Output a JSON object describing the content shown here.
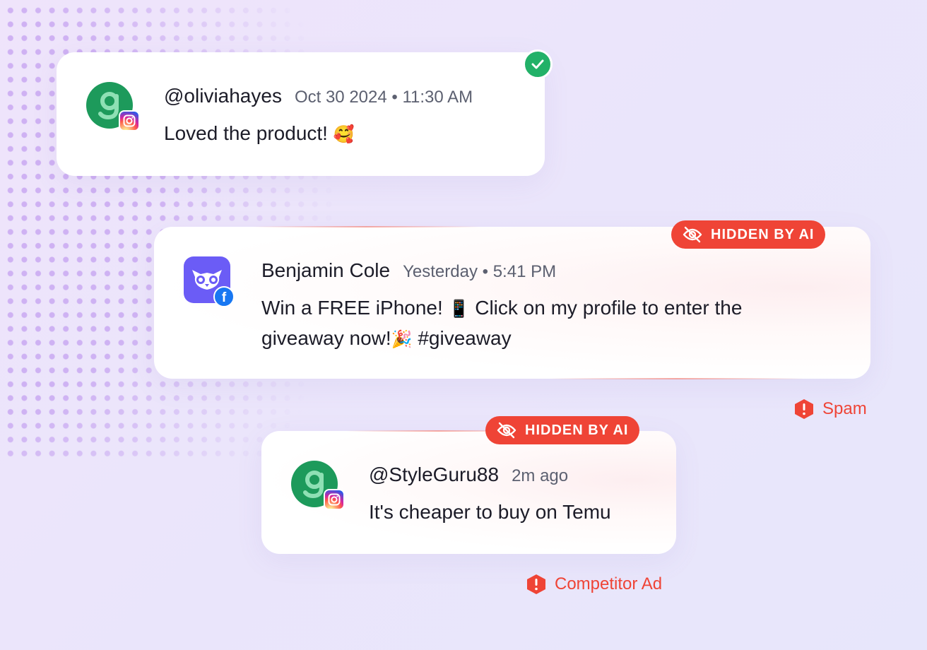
{
  "comments": [
    {
      "author": "@oliviahayes",
      "meta": "Oct 30 2024 • 11:30 AM",
      "text": "Loved the product!",
      "emoji": "🥰",
      "platform": "instagram",
      "status": "approved"
    },
    {
      "author": "Benjamin Cole",
      "meta": "Yesterday • 5:41 PM",
      "text_line1_a": "Win a FREE iPhone!",
      "text_line1_emoji": "📱",
      "text_line1_b": "Click on my profile to enter the",
      "text_line2_a": "giveaway now!",
      "text_line2_emoji": "🎉",
      "text_line2_b": "#giveaway",
      "platform": "facebook",
      "status_label": "HIDDEN BY AI",
      "reason": "Spam"
    },
    {
      "author": "@StyleGuru88",
      "meta": "2m ago",
      "text": "It's cheaper to buy on Temu",
      "platform": "instagram",
      "status_label": "HIDDEN BY AI",
      "reason": "Competitor Ad"
    }
  ],
  "icons": {
    "approved": "check-icon",
    "hidden": "eye-off-icon",
    "reason": "alert-hexagon-icon",
    "instagram": "instagram-icon",
    "facebook": "facebook-icon"
  },
  "colors": {
    "approved": "#22b168",
    "hidden": "#ef4436",
    "avatar_green": "#1d9a5b",
    "avatar_purple": "#6b5cf6",
    "facebook": "#1877f2"
  }
}
